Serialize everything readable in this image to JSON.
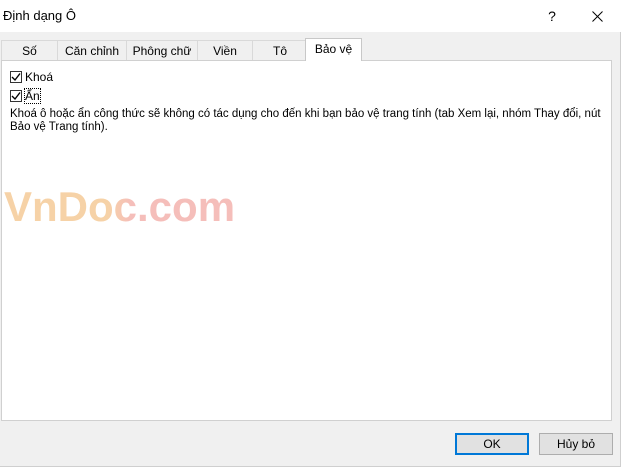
{
  "window": {
    "title": "Định dạng Ô",
    "help_label": "?"
  },
  "tabs": [
    {
      "label": "Số",
      "active": false
    },
    {
      "label": "Căn chỉnh",
      "active": false
    },
    {
      "label": "Phông chữ",
      "active": false
    },
    {
      "label": "Viền",
      "active": false
    },
    {
      "label": "Tô",
      "active": false
    },
    {
      "label": "Bảo vệ",
      "active": true
    }
  ],
  "protection": {
    "locked": {
      "label": "Khoá",
      "checked": true
    },
    "hidden": {
      "label": "Ẩn",
      "checked": true
    },
    "description": "Khoá ô hoặc ẩn công thức sẽ không có tác dụng cho đến khi bạn bảo vệ trang tính (tab Xem lại, nhóm Thay đổi, nút Bảo vệ Trang tính)."
  },
  "watermark": {
    "text": "VnDoc.com"
  },
  "buttons": {
    "ok_label": "OK",
    "cancel_label": "Hủy bỏ"
  },
  "colors": {
    "accent": "#0078d7",
    "watermark_primary": "#f4c48a",
    "watermark_secondary": "#f2a9a3"
  },
  "icons": {
    "close": "close-icon",
    "check": "checkmark-icon"
  }
}
